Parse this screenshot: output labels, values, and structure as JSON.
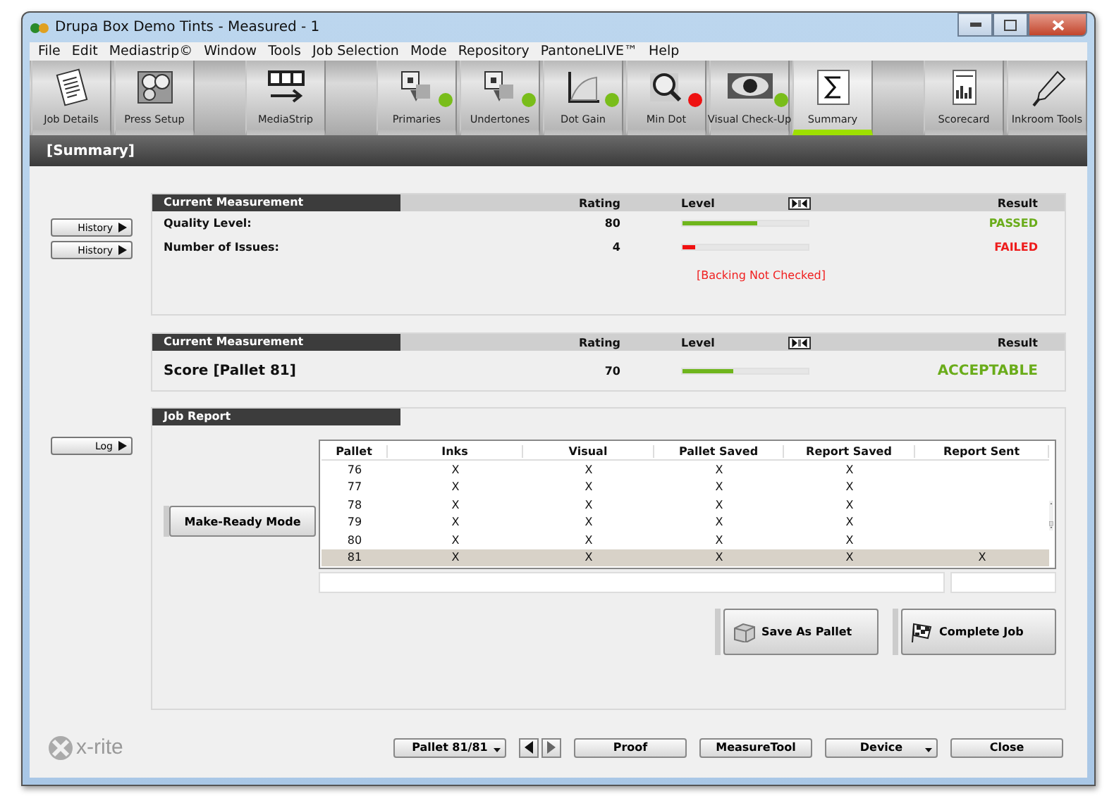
{
  "window": {
    "title": "Drupa Box Demo Tints - Measured - 1"
  },
  "menu": [
    "File",
    "Edit",
    "Mediastrip©",
    "Window",
    "Tools",
    "Job Selection",
    "Mode",
    "Repository",
    "PantoneLIVE™",
    "Help"
  ],
  "toolbar": {
    "groups": [
      [
        {
          "label": "Job Details",
          "selected": false
        },
        {
          "label": "Press Setup",
          "selected": false
        }
      ],
      [
        {
          "label": "MediaStrip",
          "selected": false
        }
      ],
      [
        {
          "label": "Primaries",
          "selected": false,
          "color": "#79bd1a"
        },
        {
          "label": "Undertones",
          "selected": false,
          "color": "#79bd1a"
        },
        {
          "label": "Dot Gain",
          "selected": false,
          "color": "#79bd1a"
        },
        {
          "label": "Min Dot",
          "selected": false,
          "color": "#ee1111"
        },
        {
          "label": "Visual Check-Up",
          "selected": false,
          "color": "#79bd1a"
        },
        {
          "label": "Summary",
          "selected": true
        }
      ],
      [
        {
          "label": "Scorecard",
          "selected": false
        },
        {
          "label": "Inkroom Tools",
          "selected": false
        }
      ]
    ]
  },
  "section_title": "[Summary]",
  "measurement": {
    "history_buttons": [
      "History",
      "History"
    ],
    "header": {
      "label": "Current Measurement",
      "rating": "Rating",
      "level": "Level",
      "result": "Result"
    },
    "rows": [
      {
        "name": "Quality Level:",
        "rating": "80",
        "level": 0.6,
        "result": "PASSED",
        "kind": "pass"
      },
      {
        "name": "Number of Issues:",
        "rating": "4",
        "level": 0.1,
        "result": "FAILED",
        "kind": "fail"
      }
    ],
    "note": "[Backing Not Checked]"
  },
  "score": {
    "header": {
      "label": "Current Measurement",
      "rating": "Rating",
      "level": "Level",
      "result": "Result"
    },
    "name": "Score [Pallet 81]",
    "rating": "70",
    "level": 0.4,
    "result": "ACCEPTABLE",
    "kind": "pass"
  },
  "job_report": {
    "title": "Job Report",
    "log_button": "Log",
    "mode_button": "Make-Ready Mode",
    "table": {
      "columns": [
        "Pallet",
        "Inks",
        "Visual",
        "Pallet Saved",
        "Report Saved",
        "Report Sent"
      ],
      "rows": [
        {
          "cells": [
            "76",
            "X",
            "X",
            "X",
            "X"
          ],
          "selected": false
        },
        {
          "cells": [
            "77",
            "X",
            "X",
            "X",
            "X"
          ],
          "selected": false
        },
        {
          "cells": [
            "78",
            "X",
            "X",
            "X",
            "X"
          ],
          "selected": false
        },
        {
          "cells": [
            "79",
            "X",
            "X",
            "X",
            "X"
          ],
          "selected": false
        },
        {
          "cells": [
            "80",
            "X",
            "X",
            "X",
            "X"
          ],
          "selected": false
        },
        {
          "cells": [
            "81",
            "X",
            "X",
            "X",
            "X",
            "X"
          ],
          "selected": true
        }
      ]
    },
    "save_button": "Save As Pallet",
    "complete_button": "Complete Job"
  },
  "footer": {
    "logo": "x-rite",
    "pallet_select": "Pallet 81/81",
    "buttons": [
      {
        "label": "Proof",
        "kind": "plain"
      },
      {
        "label": "MeasureTool",
        "kind": "plain"
      },
      {
        "label": "Device",
        "kind": "dropdown"
      },
      {
        "label": "Close",
        "kind": "plain"
      }
    ]
  }
}
